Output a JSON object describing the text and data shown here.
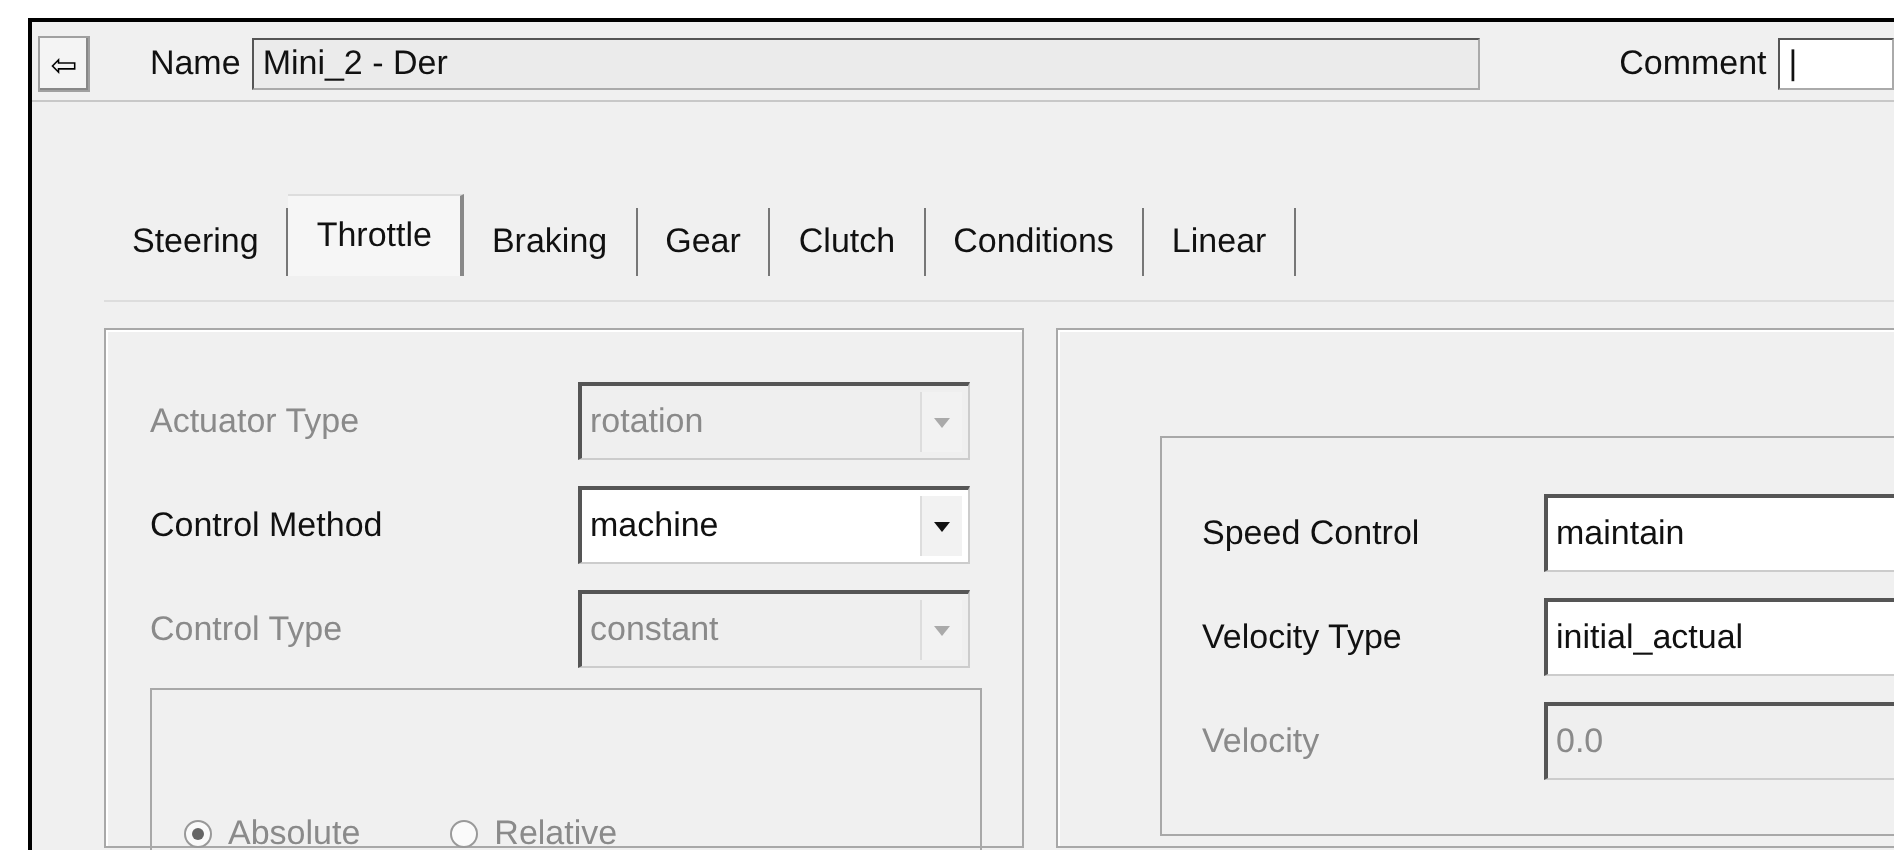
{
  "header": {
    "back_button": "⇦",
    "name_label": "Name",
    "name_value": "Mini_2 - Der",
    "comment_label": "Comment",
    "comment_value": "|"
  },
  "tabs": [
    {
      "label": "Steering",
      "selected": false
    },
    {
      "label": "Throttle",
      "selected": true
    },
    {
      "label": "Braking",
      "selected": false
    },
    {
      "label": "Gear",
      "selected": false
    },
    {
      "label": "Clutch",
      "selected": false
    },
    {
      "label": "Conditions",
      "selected": false
    },
    {
      "label": "Linear",
      "selected": false
    }
  ],
  "left_fields": [
    {
      "label": "Actuator Type",
      "value": "rotation",
      "disabled": true
    },
    {
      "label": "Control Method",
      "value": "machine",
      "disabled": false
    },
    {
      "label": "Control Type",
      "value": "constant",
      "disabled": true
    }
  ],
  "mode_radios": [
    {
      "label": "Absolute",
      "selected": true,
      "disabled": true
    },
    {
      "label": "Relative",
      "selected": false,
      "disabled": true
    }
  ],
  "right_fields": [
    {
      "label": "Speed Control",
      "value": "maintain",
      "disabled": false
    },
    {
      "label": "Velocity Type",
      "value": "initial_actual",
      "disabled": false
    },
    {
      "label": "Velocity",
      "value": "0.0",
      "disabled": true
    }
  ]
}
